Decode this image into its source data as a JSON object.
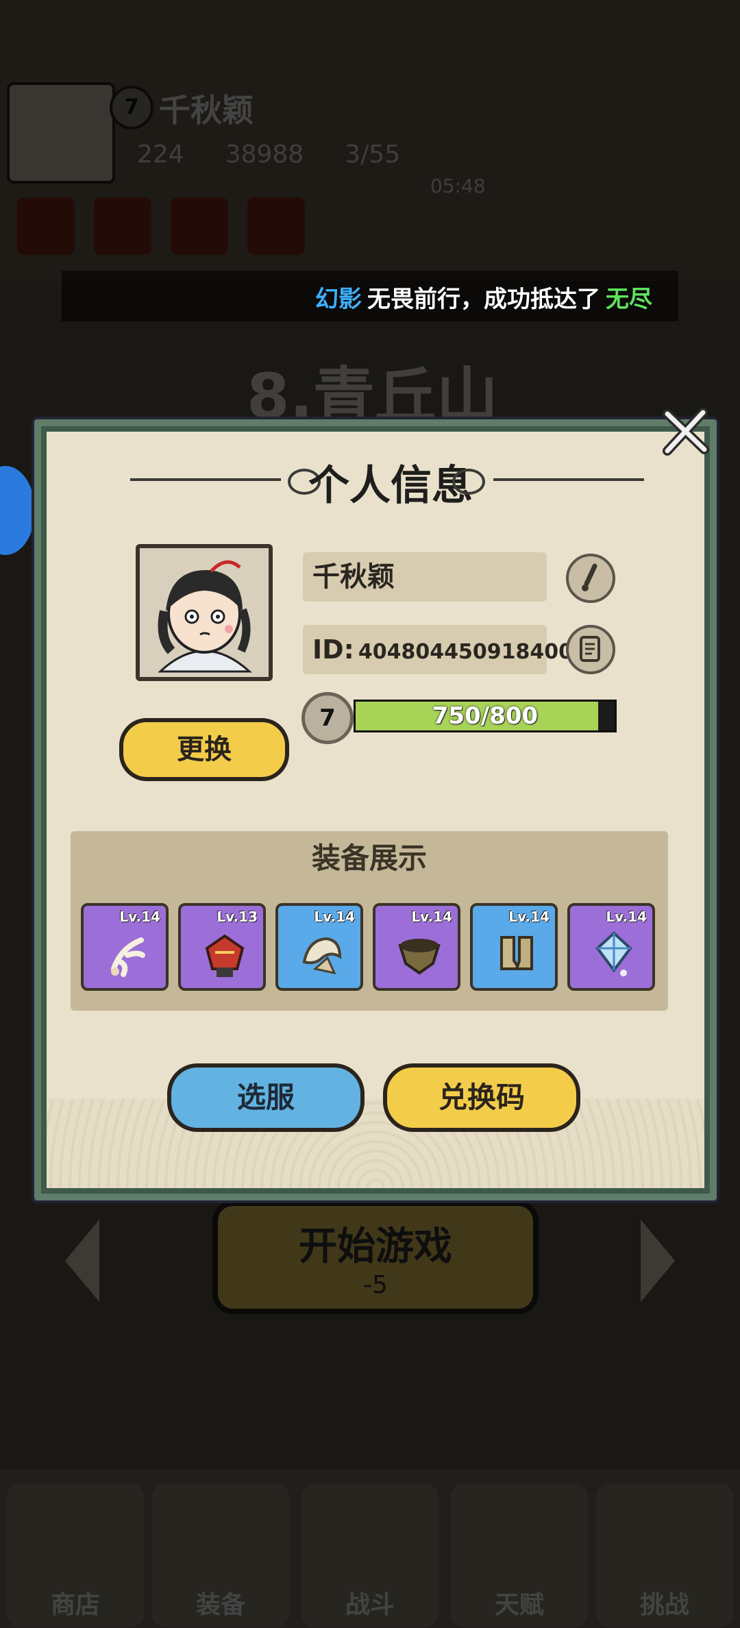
{
  "background": {
    "player_level": "7",
    "player_name": "千秋颖",
    "stats": [
      "224",
      "38988",
      "3/55"
    ],
    "timer": "05:48",
    "stage_title": "8.青丘山",
    "start_button": "开始游戏",
    "start_cost": "-5",
    "nav_tabs": [
      "商店",
      "装备",
      "战斗",
      "天赋",
      "挑战"
    ]
  },
  "ticker": {
    "player": "幻影",
    "action": "无畏前行，成功抵达了",
    "target": "无尽"
  },
  "dialog": {
    "title": "个人信息",
    "change_button": "更换",
    "name": "千秋颖",
    "id_label": "ID:",
    "id_value": "404804450918400",
    "level": "7",
    "exp_text": "750/800",
    "exp_fraction": 0.9375,
    "equipment_header": "装备展示",
    "equipment": [
      {
        "level": "Lv.14",
        "rarity": "purple",
        "icon": "feather-charm-icon"
      },
      {
        "level": "Lv.13",
        "rarity": "purple",
        "icon": "red-mask-icon"
      },
      {
        "level": "Lv.14",
        "rarity": "blue",
        "icon": "shoulder-guard-icon"
      },
      {
        "level": "Lv.14",
        "rarity": "purple",
        "icon": "gauntlet-icon"
      },
      {
        "level": "Lv.14",
        "rarity": "blue",
        "icon": "boots-icon"
      },
      {
        "level": "Lv.14",
        "rarity": "purple",
        "icon": "crystal-pendant-icon"
      }
    ],
    "server_button": "选服",
    "redeem_button": "兑换码"
  },
  "colors": {
    "purple": "#9c6ed8",
    "blue": "#5aa9e8",
    "ticker_player": "#3fb0ff",
    "ticker_target": "#5fe35f"
  }
}
